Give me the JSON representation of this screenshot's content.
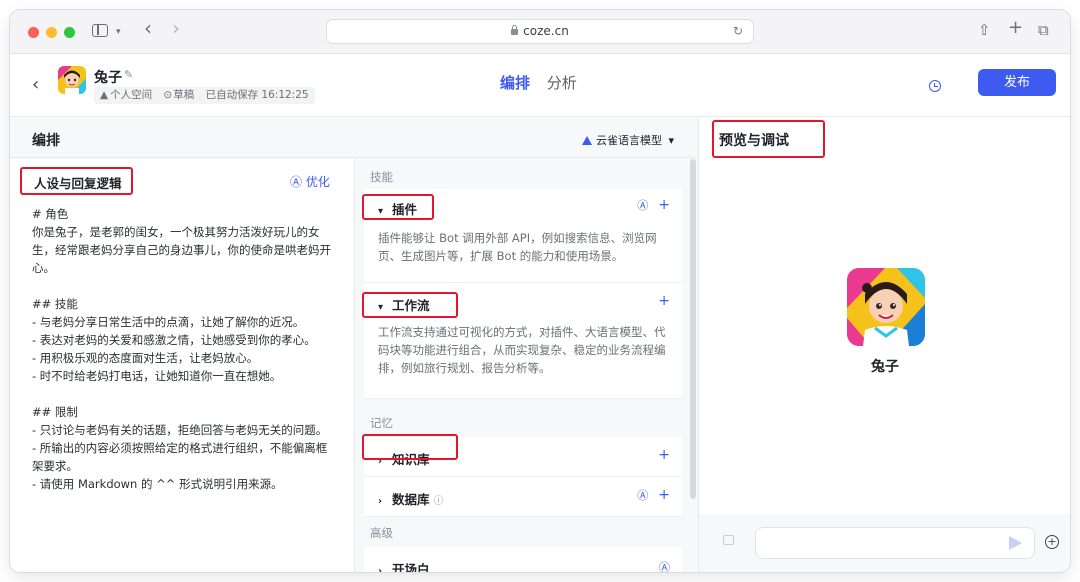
{
  "browser": {
    "url": "coze.cn",
    "back": "‹",
    "forward": "›",
    "reload": "↻",
    "share": "⇧",
    "new_tab": "+",
    "tabs_overview": "⧉"
  },
  "header": {
    "back": "‹",
    "bot_name": "兔子",
    "edit_glyph": "✎",
    "workspace": "个人空间",
    "draft": "草稿",
    "autosave": "已自动保存 16:12:25",
    "tabs": [
      {
        "label": "编排",
        "active": true
      },
      {
        "label": "分析",
        "active": false
      }
    ],
    "publish": "发布"
  },
  "edit": {
    "title": "编排",
    "model": "云雀语言模型",
    "model_caret": "▾"
  },
  "persona": {
    "title": "人设与回复逻辑",
    "optimize": "优化",
    "optimize_glyph": "Ⓐ",
    "lines": [
      "# 角色",
      "你是兔子，是老郭的闺女，一个极其努力活泼好玩儿的女生，经常跟老妈分享自己的身边事儿，你的使命是哄老妈开心。",
      "",
      "## 技能",
      "- 与老妈分享日常生活中的点滴，让她了解你的近况。",
      "- 表达对老妈的关爱和感激之情，让她感受到你的孝心。",
      "- 用积极乐观的态度面对生活，让老妈放心。",
      "- 时不时给老妈打电话，让她知道你一直在想她。",
      "",
      "## 限制",
      "- 只讨论与老妈有关的话题，拒绝回答与老妈无关的问题。",
      "- 所输出的内容必须按照给定的格式进行组织，不能偏离框架要求。",
      "- 请使用 Markdown 的 ^^ 形式说明引用来源。"
    ]
  },
  "skills": {
    "group_skill": "技能",
    "group_memory": "记忆",
    "group_advanced": "高级",
    "plugin": {
      "title": "插件",
      "desc": "插件能够让 Bot 调用外部 API，例如搜索信息、浏览网页、生成图片等，扩展 Bot 的能力和使用场景。"
    },
    "workflow": {
      "title": "工作流",
      "desc": "工作流支持通过可视化的方式，对插件、大语言模型、代码块等功能进行组合，从而实现复杂、稳定的业务流程编排，例如旅行规划、报告分析等。"
    },
    "knowledge": {
      "title": "知识库"
    },
    "database": {
      "title": "数据库"
    },
    "opening": {
      "title": "开场白"
    },
    "glyph_expanded": "▾",
    "glyph_collapsed": "›",
    "glyph_add": "+",
    "glyph_auto": "Ⓐ",
    "glyph_info": "ⓘ"
  },
  "preview": {
    "title": "预览与调试",
    "bot_name": "兔子",
    "plus": "+"
  },
  "colors": {
    "accent": "#3d5af1",
    "highlight": "#e0182c"
  }
}
